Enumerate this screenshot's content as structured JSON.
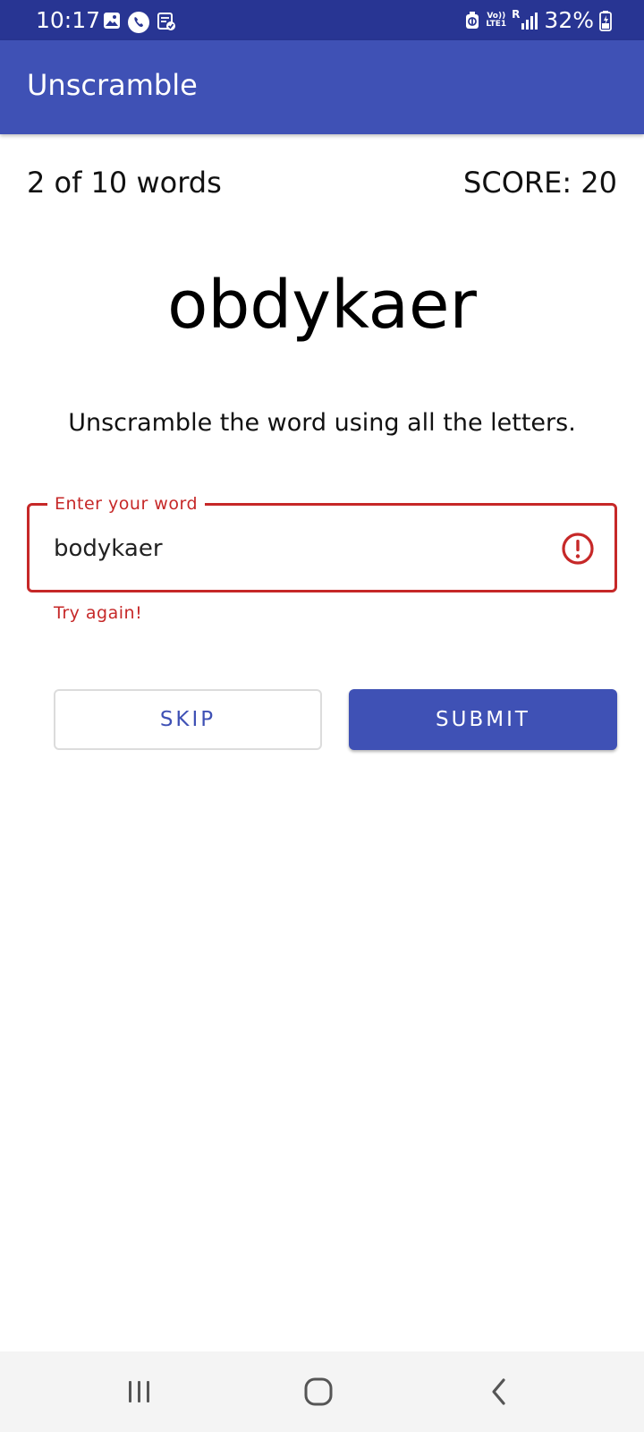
{
  "status_bar": {
    "time": "10:17",
    "network_top": "Vo))",
    "network_bottom": "LTE1",
    "roaming": "R",
    "battery": "32%"
  },
  "app_bar": {
    "title": "Unscramble"
  },
  "game": {
    "word_count": "2 of 10 words",
    "score": "SCORE: 20",
    "scrambled_word": "obdykaer",
    "instructions": "Unscramble the word using all the letters."
  },
  "input": {
    "label": "Enter your word",
    "value": "bodykaer",
    "error": "Try again!"
  },
  "buttons": {
    "skip": "SKIP",
    "submit": "SUBMIT"
  },
  "colors": {
    "status_bar": "#283593",
    "app_bar": "#3f51b5",
    "error": "#c62828",
    "primary": "#3f51b5"
  },
  "icons": {
    "status_left": [
      "gallery-icon",
      "phone-icon",
      "clipboard-check-icon"
    ],
    "status_right": [
      "data-saver-icon",
      "signal-icon",
      "battery-icon"
    ],
    "field": "error-icon",
    "nav": [
      "recents-icon",
      "home-icon",
      "back-icon"
    ]
  }
}
